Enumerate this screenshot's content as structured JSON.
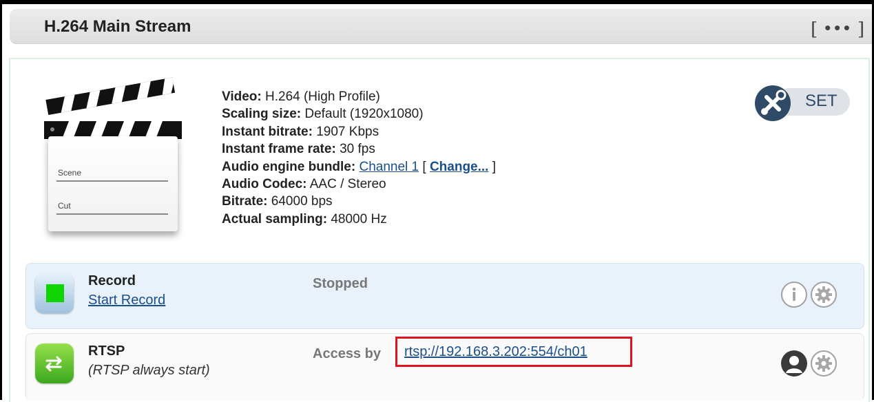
{
  "header": {
    "title": "H.264 Main Stream",
    "more_button": "•••"
  },
  "clapperboard": {
    "scene_label": "Scene",
    "cut_label": "Cut"
  },
  "details": {
    "video_label": "Video:",
    "video_value": "H.264 (High Profile)",
    "scaling_label": "Scaling size:",
    "scaling_value": "Default (1920x1080)",
    "bitrate_label": "Instant bitrate:",
    "bitrate_value": "1907 Kbps",
    "framerate_label": "Instant frame rate:",
    "framerate_value": "30 fps",
    "audio_bundle_label": "Audio engine bundle:",
    "audio_bundle_value": "Channel 1",
    "change_link": "Change...",
    "audio_codec_label": "Audio Codec:",
    "audio_codec_value": "AAC / Stereo",
    "audio_bitrate_label": "Bitrate:",
    "audio_bitrate_value": "64000 bps",
    "sampling_label": "Actual sampling:",
    "sampling_value": "48000 Hz"
  },
  "set_button": {
    "label": "SET"
  },
  "record": {
    "title": "Record",
    "action": "Start Record",
    "status": "Stopped"
  },
  "rtsp": {
    "title": "RTSP",
    "subtitle": "(RTSP always start)",
    "access_label": "Access by",
    "url": "rtsp://192.168.3.202:554/ch01"
  }
}
